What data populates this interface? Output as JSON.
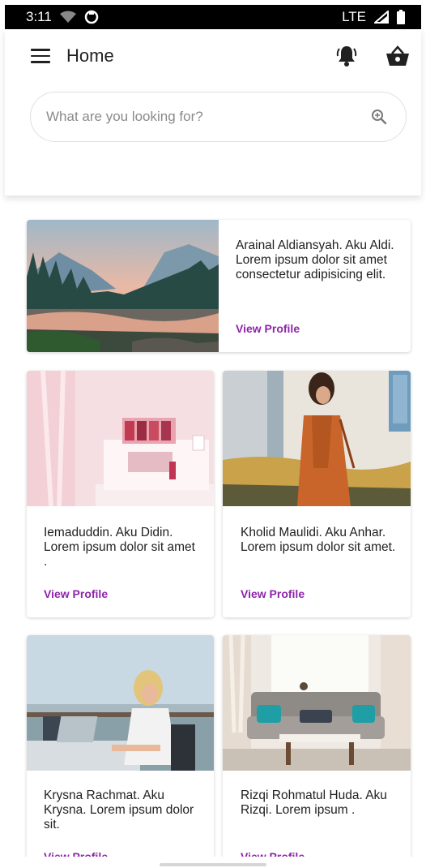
{
  "status_bar": {
    "time": "3:11",
    "network": "LTE"
  },
  "app_bar": {
    "title": "Home",
    "menu_icon": "hamburger-menu-icon",
    "notification_icon": "bell-ring-icon",
    "cart_icon": "basket-icon"
  },
  "search": {
    "placeholder": "What are you looking for?",
    "icon": "search-icon"
  },
  "colors": {
    "accent": "#8e24aa",
    "text": "#212121",
    "status_bar": "#000000"
  },
  "cards": [
    {
      "image": "mountain-lake-landscape",
      "text": "Arainal Aldiansyah. Aku Aldi. Lorem ipsum dolor sit amet consectetur adipisicing elit.",
      "link": "View Profile"
    },
    {
      "image": "pink-cosmetics-shelf",
      "text": "Iemaduddin. Aku Didin. Lorem ipsum dolor sit amet .",
      "link": "View Profile"
    },
    {
      "image": "woman-orange-coat",
      "text": "Kholid Maulidi. Aku Anhar. Lorem ipsum dolor sit amet.",
      "link": "View Profile"
    },
    {
      "image": "woman-laptop-terrace",
      "text": "Krysna Rachmat. Aku Krysna. Lorem ipsum dolor sit.",
      "link": "View Profile"
    },
    {
      "image": "living-room-sofa",
      "text": "Rizqi Rohmatul Huda. Aku Rizqi. Lorem ipsum .",
      "link": "View Profile"
    }
  ]
}
